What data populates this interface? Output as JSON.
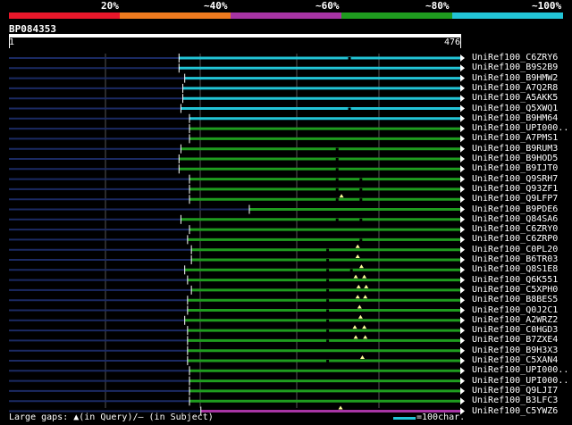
{
  "legend": {
    "colors": [
      "#e8172a",
      "#ee7a1e",
      "#a734a4",
      "#1f9c1f",
      "#22c4d6"
    ],
    "labels": [
      "20%",
      "~40%",
      "~60%",
      "~80%",
      "~100%"
    ]
  },
  "query": {
    "name": "BP084353",
    "start": "1",
    "end": "476",
    "length": 476
  },
  "hits": [
    {
      "label": "UniRef100_C6ZRY6",
      "start": 180,
      "color": "#22c4d6",
      "gaps_query": [],
      "gaps_subject": [
        358
      ]
    },
    {
      "label": "UniRef100_B9S2B9",
      "start": 180,
      "color": "#22c4d6",
      "gaps_query": [],
      "gaps_subject": []
    },
    {
      "label": "UniRef100_B9HMW2",
      "start": 186,
      "color": "#22c4d6",
      "gaps_query": [],
      "gaps_subject": []
    },
    {
      "label": "UniRef100_A7Q2R8",
      "start": 184,
      "color": "#22c4d6",
      "gaps_query": [],
      "gaps_subject": []
    },
    {
      "label": "UniRef100_A5AKK5",
      "start": 184,
      "color": "#22c4d6",
      "gaps_query": [],
      "gaps_subject": []
    },
    {
      "label": "UniRef100_Q5XWQ1",
      "start": 182,
      "color": "#22c4d6",
      "gaps_query": [],
      "gaps_subject": [
        358
      ]
    },
    {
      "label": "UniRef100_B9HM64",
      "start": 191,
      "color": "#22c4d6",
      "gaps_query": [],
      "gaps_subject": []
    },
    {
      "label": "UniRef100_UPI000..",
      "start": 191,
      "color": "#1f9c1f",
      "gaps_query": [],
      "gaps_subject": []
    },
    {
      "label": "UniRef100_A7PMS1",
      "start": 191,
      "color": "#1f9c1f",
      "gaps_query": [],
      "gaps_subject": []
    },
    {
      "label": "UniRef100_B9RUM3",
      "start": 182,
      "color": "#1f9c1f",
      "gaps_query": [],
      "gaps_subject": [
        345
      ]
    },
    {
      "label": "UniRef100_B9HOD5",
      "start": 180,
      "color": "#1f9c1f",
      "gaps_query": [],
      "gaps_subject": [
        345
      ]
    },
    {
      "label": "UniRef100_B9IJT0",
      "start": 180,
      "color": "#1f9c1f",
      "gaps_query": [],
      "gaps_subject": [
        345
      ]
    },
    {
      "label": "UniRef100_Q9SRH7",
      "start": 191,
      "color": "#1f9c1f",
      "gaps_query": [],
      "gaps_subject": [
        345,
        370
      ]
    },
    {
      "label": "UniRef100_Q93ZF1",
      "start": 191,
      "color": "#1f9c1f",
      "gaps_query": [],
      "gaps_subject": [
        345,
        370
      ]
    },
    {
      "label": "UniRef100_Q9LFP7",
      "start": 191,
      "color": "#1f9c1f",
      "gaps_query": [
        351
      ],
      "gaps_subject": [
        345,
        370
      ]
    },
    {
      "label": "UniRef100_B9PDE6",
      "start": 254,
      "color": "#1f9c1f",
      "gaps_query": [],
      "gaps_subject": []
    },
    {
      "label": "UniRef100_Q84SA6",
      "start": 182,
      "color": "#1f9c1f",
      "gaps_query": [],
      "gaps_subject": [
        345,
        370
      ]
    },
    {
      "label": "UniRef100_C6ZRY0",
      "start": 191,
      "color": "#1f9c1f",
      "gaps_query": [],
      "gaps_subject": []
    },
    {
      "label": "UniRef100_C6ZRP0",
      "start": 189,
      "color": "#1f9c1f",
      "gaps_query": [],
      "gaps_subject": [
        370
      ]
    },
    {
      "label": "UniRef100_C0PL20",
      "start": 193,
      "color": "#1f9c1f",
      "gaps_query": [
        368
      ],
      "gaps_subject": [
        335
      ]
    },
    {
      "label": "UniRef100_B6TR03",
      "start": 193,
      "color": "#1f9c1f",
      "gaps_query": [
        368
      ],
      "gaps_subject": [
        335
      ]
    },
    {
      "label": "UniRef100_Q8S1E8",
      "start": 186,
      "color": "#1f9c1f",
      "gaps_query": [
        372
      ],
      "gaps_subject": [
        335,
        360
      ]
    },
    {
      "label": "UniRef100_Q6K551",
      "start": 189,
      "color": "#1f9c1f",
      "gaps_query": [
        366,
        375
      ],
      "gaps_subject": [
        335
      ]
    },
    {
      "label": "UniRef100_C5XPH0",
      "start": 193,
      "color": "#1f9c1f",
      "gaps_query": [
        369,
        377
      ],
      "gaps_subject": [
        335
      ]
    },
    {
      "label": "UniRef100_B8BES5",
      "start": 189,
      "color": "#1f9c1f",
      "gaps_query": [
        368,
        376
      ],
      "gaps_subject": [
        335
      ]
    },
    {
      "label": "UniRef100_Q0J2C1",
      "start": 189,
      "color": "#1f9c1f",
      "gaps_query": [
        370
      ],
      "gaps_subject": [
        335
      ]
    },
    {
      "label": "UniRef100_A2WRZ2",
      "start": 186,
      "color": "#1f9c1f",
      "gaps_query": [
        371
      ],
      "gaps_subject": [
        335
      ]
    },
    {
      "label": "UniRef100_C0HGD3",
      "start": 189,
      "color": "#1f9c1f",
      "gaps_query": [
        365,
        375
      ],
      "gaps_subject": [
        335
      ]
    },
    {
      "label": "UniRef100_B7ZXE4",
      "start": 189,
      "color": "#1f9c1f",
      "gaps_query": [
        366,
        376
      ],
      "gaps_subject": [
        335
      ]
    },
    {
      "label": "UniRef100_B9H3X3",
      "start": 189,
      "color": "#1f9c1f",
      "gaps_query": [],
      "gaps_subject": []
    },
    {
      "label": "UniRef100_C5XAN4",
      "start": 189,
      "color": "#1f9c1f",
      "gaps_query": [
        373
      ],
      "gaps_subject": [
        335
      ]
    },
    {
      "label": "UniRef100_UPI000..",
      "start": 191,
      "color": "#1f9c1f",
      "gaps_query": [],
      "gaps_subject": []
    },
    {
      "label": "UniRef100_UPI000..",
      "start": 191,
      "color": "#1f9c1f",
      "gaps_query": [],
      "gaps_subject": []
    },
    {
      "label": "UniRef100_Q9LJI7",
      "start": 191,
      "color": "#1f9c1f",
      "gaps_query": [],
      "gaps_subject": []
    },
    {
      "label": "UniRef100_B3LFC3",
      "start": 191,
      "color": "#1f9c1f",
      "gaps_query": [],
      "gaps_subject": []
    },
    {
      "label": "UniRef100_C5YWZ6",
      "start": 203,
      "color": "#a734a4",
      "gaps_query": [
        350
      ],
      "gaps_subject": []
    }
  ],
  "footer": {
    "left": "Large gaps: ▲(in Query)/— (in Subject)",
    "right": "=100char."
  }
}
